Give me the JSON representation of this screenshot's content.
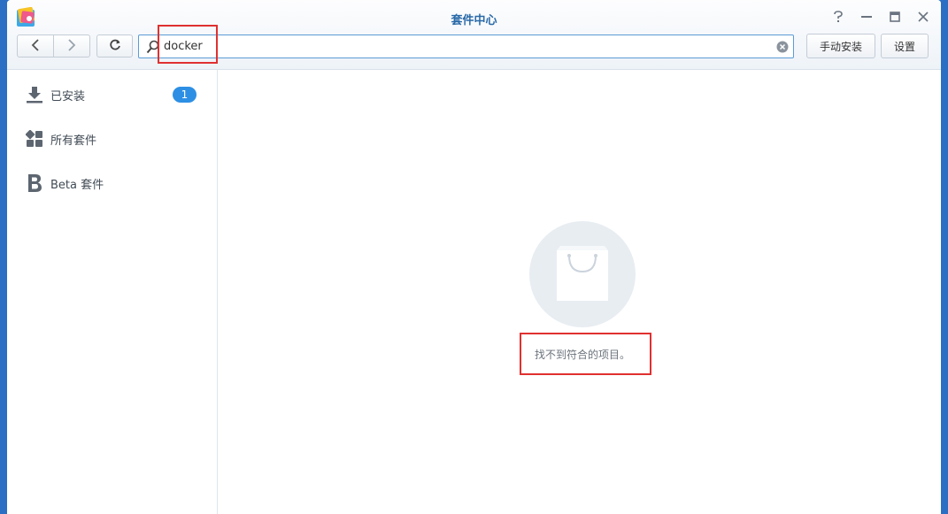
{
  "window": {
    "title": "套件中心",
    "controls": [
      "help-icon",
      "minimize-icon",
      "maximize-icon",
      "close-icon"
    ]
  },
  "toolbar": {
    "search_value": "docker",
    "manual_install_label": "手动安装",
    "settings_label": "设置"
  },
  "sidebar": {
    "items": [
      {
        "label": "已安装",
        "icon": "download-icon",
        "badge": "1"
      },
      {
        "label": "所有套件",
        "icon": "grid-icon"
      },
      {
        "label": "Beta 套件",
        "icon": "beta-icon"
      }
    ]
  },
  "main": {
    "empty_message": "找不到符合的项目。",
    "empty_icon": "shopping-bag-icon"
  },
  "colors": {
    "title": "#2a6aa8",
    "badge": "#2d8fe4",
    "highlight": "#e03030",
    "search_border": "#5b9bd5"
  }
}
